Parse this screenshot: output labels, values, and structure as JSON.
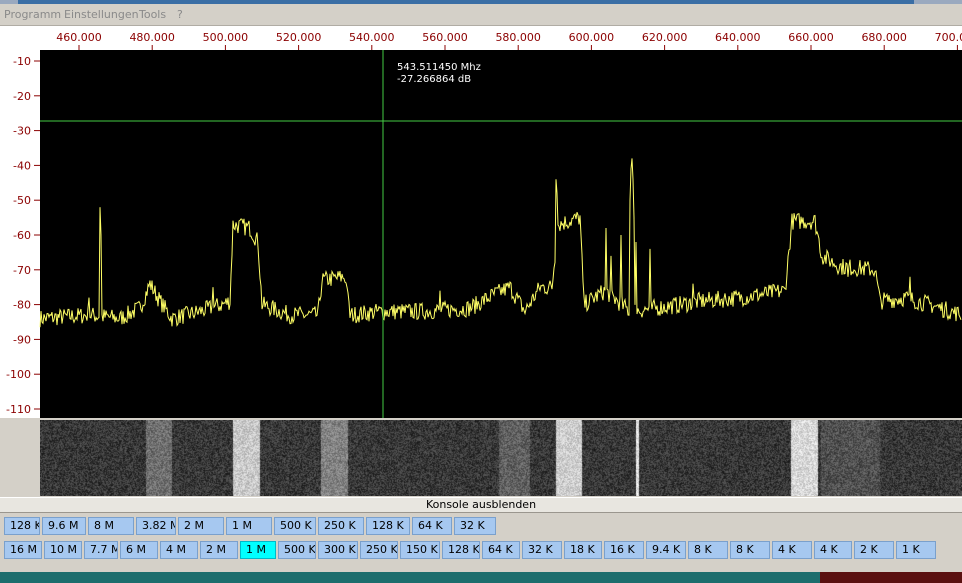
{
  "menu": {
    "items": [
      "Programm",
      "Einstellungen",
      "Tools",
      "?"
    ]
  },
  "cursor": {
    "frequency": "543.511450 Mhz",
    "level": "-27.266864 dB"
  },
  "spectrum": {
    "x_ticks": [
      "460.000",
      "480.000",
      "500.000",
      "520.000",
      "540.000",
      "560.000",
      "580.000",
      "600.000",
      "620.000",
      "640.000",
      "660.000",
      "680.000",
      "700.000"
    ],
    "y_ticks": [
      "-10",
      "-20",
      "-30",
      "-40",
      "-50",
      "-60",
      "-70",
      "-80",
      "-90",
      "-100",
      "-110"
    ],
    "trace_color": "#ffff66",
    "cursor_color": "#44cc44",
    "axis_color": "#8b0000"
  },
  "konsole_label": "Konsole ausblenden",
  "bandwidth_row": [
    "128 K",
    "9.6 M",
    "8 M",
    "3.82 M",
    "2 M",
    "1 M",
    "500 K",
    "250 K",
    "128 K",
    "64 K",
    "32 K"
  ],
  "span_row": [
    "16 M",
    "10 M",
    "7.7 M",
    "6 M",
    "4 M",
    "2 M",
    "1 M",
    "500 K",
    "300 K",
    "250 K",
    "150 K",
    "128 K",
    "64 K",
    "32 K",
    "18 K",
    "16 K",
    "9.4 K",
    "8 K",
    "8 K",
    "4 K",
    "4 K",
    "2 K",
    "1 K"
  ],
  "span_active": "1 M",
  "colors": {
    "button": "#a6c8f0",
    "button_active": "#00ffff"
  }
}
